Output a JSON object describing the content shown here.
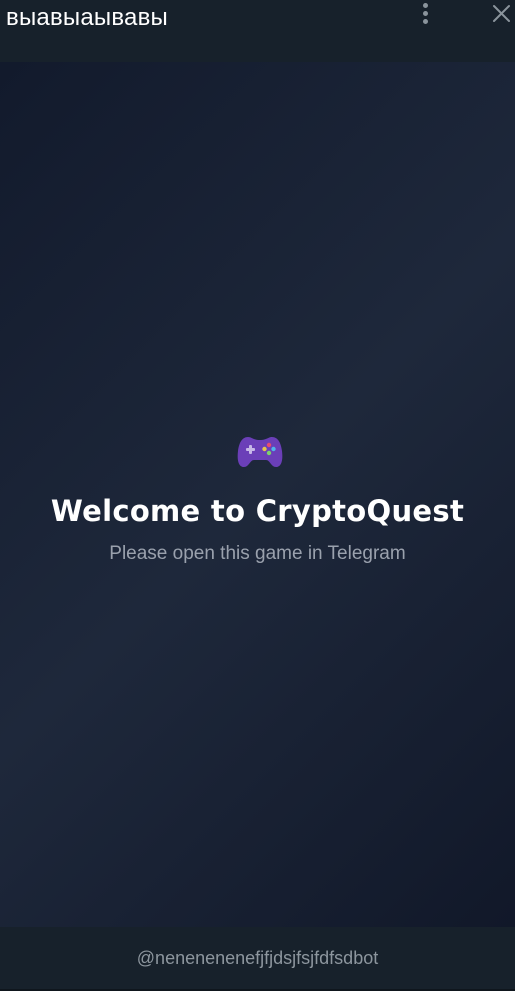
{
  "header": {
    "title": "выавыаывавы",
    "menu_icon": "more-vertical-icon",
    "close_icon": "close-icon"
  },
  "main": {
    "icon": "gamepad-icon",
    "heading": "Welcome to CryptoQuest",
    "subtitle": "Please open this game in Telegram"
  },
  "footer": {
    "bot_username": "@nenenenenefjfjdsjfsjfdfsdbot"
  },
  "colors": {
    "header_bg": "#17212b",
    "content_gradient_dark": "#121a2c",
    "content_gradient_light": "#1e283b",
    "gamepad_body": "#6b3fb8",
    "heading_text": "#ffffff",
    "subtitle_text": "#9aa1ad",
    "footer_text": "#8d969e"
  }
}
